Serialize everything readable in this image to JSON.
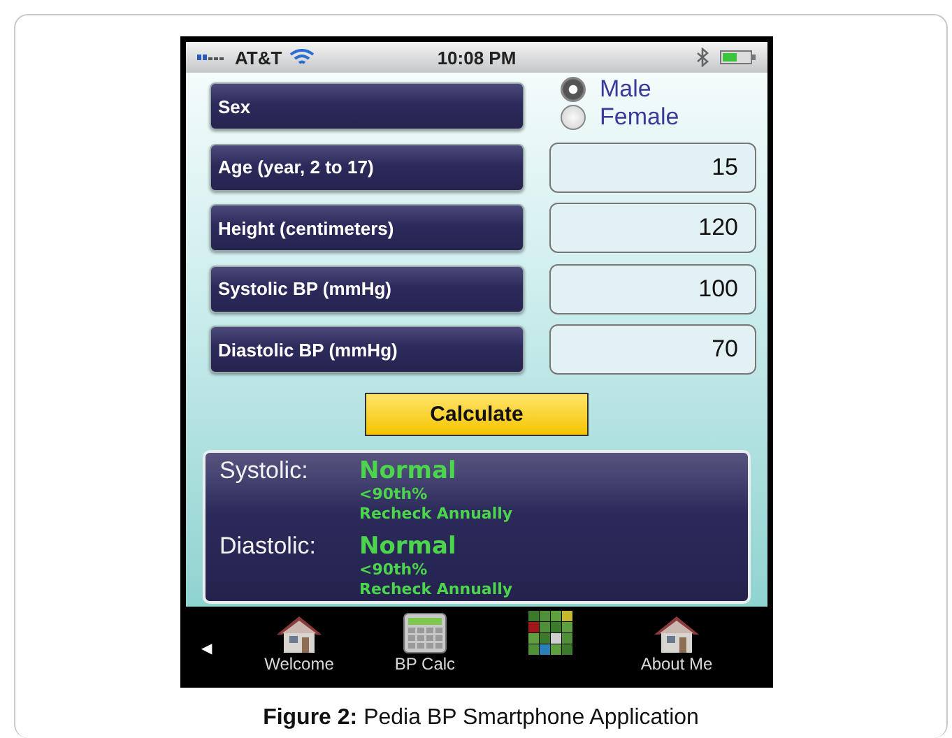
{
  "status_bar": {
    "carrier": "AT&T",
    "time": "10:08 PM"
  },
  "form": {
    "sex": {
      "label": "Sex",
      "options": [
        {
          "label": "Male",
          "selected": true
        },
        {
          "label": "Female",
          "selected": false
        }
      ]
    },
    "fields": [
      {
        "label": "Age (year, 2 to 17)",
        "value": "15"
      },
      {
        "label": "Height (centimeters)",
        "value": "120"
      },
      {
        "label": "Systolic BP (mmHg)",
        "value": "100"
      },
      {
        "label": "Diastolic BP (mmHg)",
        "value": "70"
      }
    ]
  },
  "calculate_button": "Calculate",
  "results": [
    {
      "label": "Systolic:",
      "status": "Normal",
      "percentile": "<90th%",
      "advice": "Recheck Annually"
    },
    {
      "label": "Diastolic:",
      "status": "Normal",
      "percentile": "<90th%",
      "advice": "Recheck Annually"
    }
  ],
  "tab_bar": {
    "back": "◀",
    "items": [
      {
        "label": "Welcome",
        "kind": "house",
        "selected": false
      },
      {
        "label": "BP Calc",
        "kind": "calculator",
        "selected": false
      },
      {
        "kind": "grid",
        "selected": false
      },
      {
        "label": "About Me",
        "kind": "house",
        "selected": false
      }
    ]
  },
  "caption": "**Figure 2:** Pedia BP Smartphone Application"
}
